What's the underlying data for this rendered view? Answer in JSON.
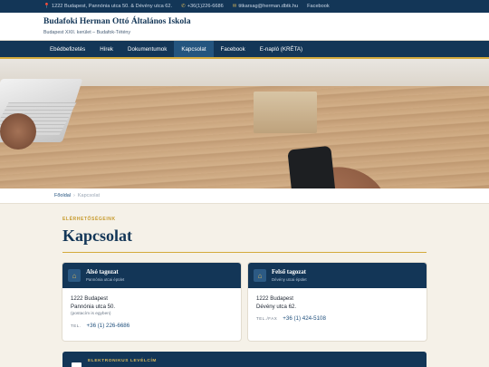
{
  "topbar": {
    "address": "1222 Budapest, Pannónia utca 50. & Dévény utca 62.",
    "phone": "+36(1)226-6686",
    "email": "titkarsag@herman.dbtk.hu",
    "facebook": "Facebook",
    "icons": [
      "pin-icon",
      "phone-icon",
      "mail-icon"
    ]
  },
  "header": {
    "title": "Budafoki Herman Ottó Általános Iskola",
    "subtitle": "Budapest XXII. kerület – Budafok-Tétény"
  },
  "nav": {
    "items": [
      {
        "label": "Ebédbefizetés"
      },
      {
        "label": "Hírek"
      },
      {
        "label": "Dokumentumok"
      },
      {
        "label": "Kapcsolat"
      },
      {
        "label": "Facebook"
      },
      {
        "label": "E-napló (KRÉTA)"
      }
    ],
    "active": "Kapcsolat"
  },
  "breadcrumb": {
    "home": "Főoldal",
    "separator": "›",
    "current": "Kapcsolat"
  },
  "main": {
    "eyebrow": "ELÉRHETŐSÉGEINK",
    "title": "Kapcsolat"
  },
  "cards": [
    {
      "title": "Alsó tagozat",
      "subtitle": "Pannónia utcai épület",
      "address_line1": "1222 Budapest",
      "address_line2": "Pannónia utca 50.",
      "note": "(postacím is egyben)",
      "tel_label": "TEL.",
      "tel": "+36 (1) 226-6686"
    },
    {
      "title": "Felső tagozat",
      "subtitle": "Dévény utcai épület",
      "address_line1": "1222 Budapest",
      "address_line2": "Dévény utca 62.",
      "tel_label": "TEL./FAX",
      "tel": "+36 (1) 424-5108"
    }
  ],
  "email_section": {
    "label": "ELEKTRONIKUS LEVÉLCÍM"
  },
  "colors": {
    "navy": "#133657",
    "gold": "#d4aa3c",
    "background": "#f5f1e8",
    "link": "#1f4f7c"
  }
}
